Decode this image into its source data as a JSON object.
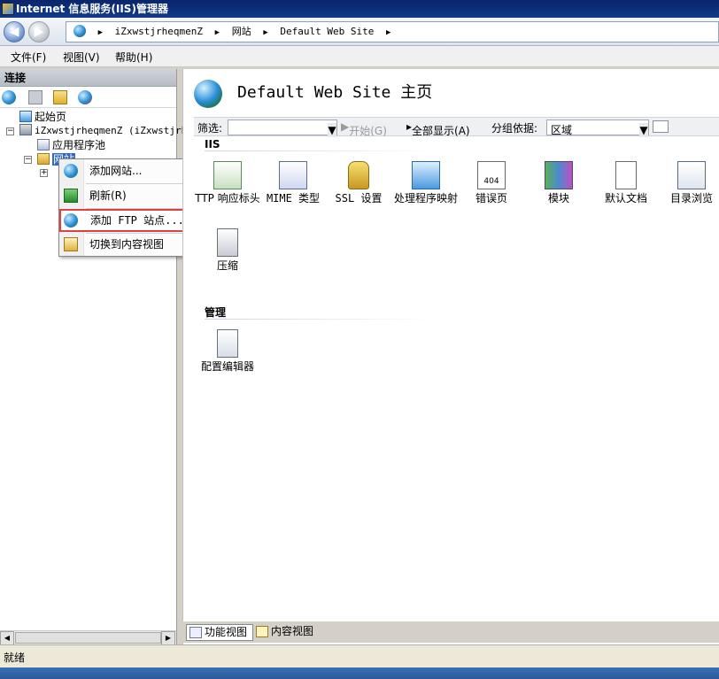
{
  "window": {
    "title": "Internet 信息服务(IIS)管理器"
  },
  "address": {
    "segments": [
      "iZxwstjrheqmenZ",
      "网站",
      "Default Web Site"
    ]
  },
  "menu": {
    "items": [
      "文件(F)",
      "视图(V)",
      "帮助(H)"
    ]
  },
  "connections": {
    "header": "连接",
    "tree": {
      "start_page": "起始页",
      "server": "iZxwstjrheqmenZ (iZxwstjrh",
      "app_pools": "应用程序池",
      "sites": "网站"
    }
  },
  "context_menu": {
    "items": [
      "添加网站...",
      "刷新(R)",
      "添加 FTP 站点...",
      "切换到内容视图"
    ],
    "highlighted_index": 2,
    "highlight_color": "#e04040"
  },
  "main": {
    "title": "Default Web Site 主页",
    "filter": {
      "label": "筛选:",
      "start_label": "开始(G)",
      "show_all_label": "全部显示(A)",
      "group_by_label": "分组依据:",
      "group_by_value": "区域"
    },
    "sections": [
      {
        "title": "IIS",
        "features": [
          {
            "label": "TTP 响应标头",
            "icon": "http-response-headers-icon"
          },
          {
            "label": "MIME 类型",
            "icon": "mime-types-icon"
          },
          {
            "label": "SSL 设置",
            "icon": "ssl-settings-lock-icon"
          },
          {
            "label": "处理程序映射",
            "icon": "handler-mappings-icon"
          },
          {
            "label": "错误页",
            "icon": "error-pages-404-icon"
          },
          {
            "label": "模块",
            "icon": "modules-icon"
          },
          {
            "label": "默认文档",
            "icon": "default-document-icon"
          },
          {
            "label": "目录浏览",
            "icon": "directory-browsing-icon"
          },
          {
            "label": "压缩",
            "icon": "compression-icon"
          }
        ]
      },
      {
        "title": "管理",
        "features": [
          {
            "label": "配置编辑器",
            "icon": "configuration-editor-icon"
          }
        ]
      }
    ],
    "error_page_badge": "404"
  },
  "bottom_tabs": [
    "功能视图",
    "内容视图"
  ],
  "status": {
    "text": "就绪"
  },
  "colors": {
    "titlebar": "#0a246a",
    "accent": "#2a8ed8",
    "taskbar": "#3c6eb4"
  }
}
